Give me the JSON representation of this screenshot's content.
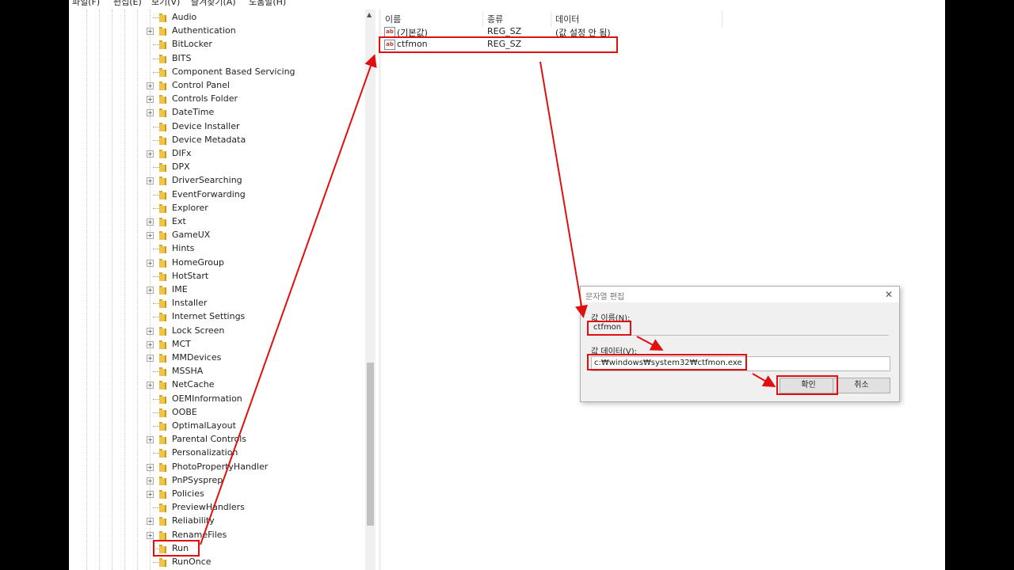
{
  "menu": [
    "파일(F)",
    "편집(E)",
    "보기(V)",
    "즐겨찾기(A)",
    "도움말(H)"
  ],
  "tree": [
    {
      "label": "Audio",
      "expandable": false
    },
    {
      "label": "Authentication",
      "expandable": true
    },
    {
      "label": "BitLocker",
      "expandable": false
    },
    {
      "label": "BITS",
      "expandable": false
    },
    {
      "label": "Component Based Servicing",
      "expandable": false
    },
    {
      "label": "Control Panel",
      "expandable": true
    },
    {
      "label": "Controls Folder",
      "expandable": true
    },
    {
      "label": "DateTime",
      "expandable": true
    },
    {
      "label": "Device Installer",
      "expandable": false
    },
    {
      "label": "Device Metadata",
      "expandable": false
    },
    {
      "label": "DIFx",
      "expandable": true
    },
    {
      "label": "DPX",
      "expandable": false
    },
    {
      "label": "DriverSearching",
      "expandable": true
    },
    {
      "label": "EventForwarding",
      "expandable": false
    },
    {
      "label": "Explorer",
      "expandable": false
    },
    {
      "label": "Ext",
      "expandable": true
    },
    {
      "label": "GameUX",
      "expandable": true
    },
    {
      "label": "Hints",
      "expandable": false
    },
    {
      "label": "HomeGroup",
      "expandable": true
    },
    {
      "label": "HotStart",
      "expandable": false
    },
    {
      "label": "IME",
      "expandable": true
    },
    {
      "label": "Installer",
      "expandable": false
    },
    {
      "label": "Internet Settings",
      "expandable": false
    },
    {
      "label": "Lock Screen",
      "expandable": true
    },
    {
      "label": "MCT",
      "expandable": true
    },
    {
      "label": "MMDevices",
      "expandable": true
    },
    {
      "label": "MSSHA",
      "expandable": false
    },
    {
      "label": "NetCache",
      "expandable": true
    },
    {
      "label": "OEMInformation",
      "expandable": false
    },
    {
      "label": "OOBE",
      "expandable": false
    },
    {
      "label": "OptimalLayout",
      "expandable": false
    },
    {
      "label": "Parental Controls",
      "expandable": true
    },
    {
      "label": "Personalization",
      "expandable": false
    },
    {
      "label": "PhotoPropertyHandler",
      "expandable": true
    },
    {
      "label": "PnPSysprep",
      "expandable": true
    },
    {
      "label": "Policies",
      "expandable": true
    },
    {
      "label": "PreviewHandlers",
      "expandable": false
    },
    {
      "label": "Reliability",
      "expandable": true
    },
    {
      "label": "RenameFiles",
      "expandable": true
    },
    {
      "label": "Run",
      "expandable": false
    },
    {
      "label": "RunOnce",
      "expandable": false
    }
  ],
  "list": {
    "headers": {
      "name": "이름",
      "type": "종류",
      "data": "데이터"
    },
    "rows": [
      {
        "name": "(기본값)",
        "type": "REG_SZ",
        "data": "(값 설정 안 됨)"
      },
      {
        "name": "ctfmon",
        "type": "REG_SZ",
        "data": ""
      }
    ]
  },
  "dialog": {
    "title": "문자열 편집",
    "name_label": "값 이름(N):",
    "name_value": "ctfmon",
    "data_label": "값 데이터(V):",
    "data_value": "c:₩windows₩system32₩ctfmon.exe",
    "ok_label": "확인",
    "cancel_label": "취소",
    "close_glyph": "✕"
  },
  "colors": {
    "highlight": "#e01010",
    "folder": "#f0c34a"
  }
}
